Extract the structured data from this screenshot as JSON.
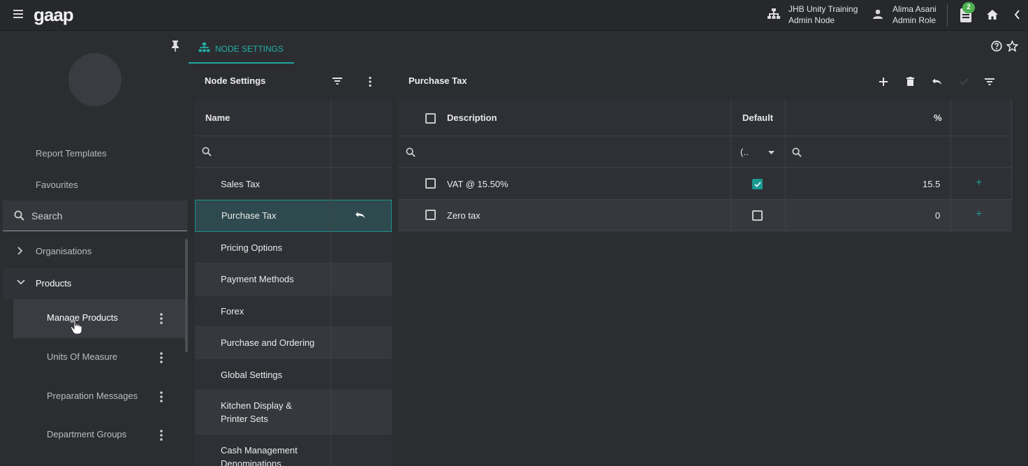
{
  "app": {
    "logo": "gaap",
    "node_name": "JHB Unity Training",
    "node_sub": "Admin Node",
    "user_name": "Alima Asani",
    "user_role": "Admin Role",
    "notification_count": "2"
  },
  "sidebar": {
    "links": [
      "Report Templates",
      "Favourites"
    ],
    "search_label": "Search",
    "tree": [
      {
        "label": "Organisations",
        "expanded": false
      },
      {
        "label": "Products",
        "expanded": true
      }
    ],
    "sub_items": [
      "Manage Products",
      "Units Of Measure",
      "Preparation Messages",
      "Department Groups"
    ]
  },
  "tab": {
    "label": "NODE SETTINGS"
  },
  "left_panel": {
    "title": "Node Settings",
    "column": "Name",
    "rows": [
      "Sales Tax",
      "Purchase Tax",
      "Pricing Options",
      "Payment Methods",
      "Forex",
      "Purchase and Ordering",
      "Global Settings",
      "Kitchen Display & Printer Sets",
      "Cash Management Denominations"
    ],
    "selected_index": 1
  },
  "right_panel": {
    "title": "Purchase Tax",
    "columns": {
      "description": "Description",
      "default": "Default",
      "percent": "%"
    },
    "default_filter": "(..",
    "rows": [
      {
        "description": "VAT @ 15.50%",
        "default": true,
        "percent": "15.5"
      },
      {
        "description": "Zero tax",
        "default": false,
        "percent": "0"
      }
    ]
  },
  "colors": {
    "accent": "#1fa7a0",
    "background": "#2b2d31",
    "badge": "#4caf50"
  }
}
